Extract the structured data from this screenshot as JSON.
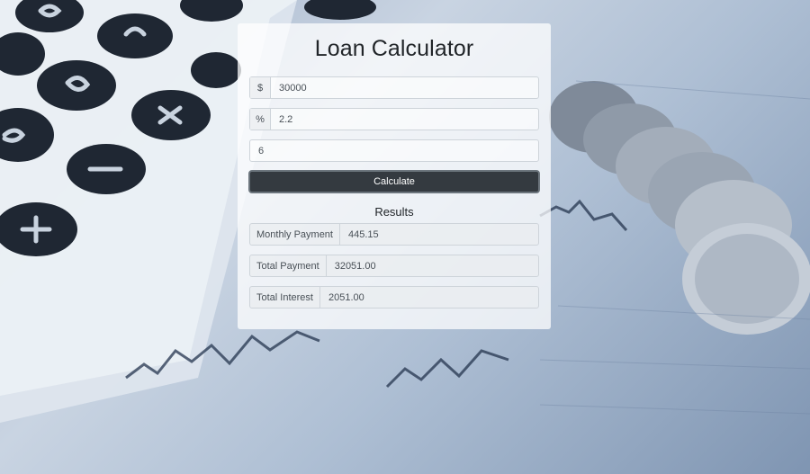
{
  "page": {
    "title": "Loan Calculator"
  },
  "form": {
    "amount": {
      "prefix": "$",
      "value": "30000"
    },
    "interest": {
      "prefix": "%",
      "value": "2.2"
    },
    "years": {
      "value": "6"
    },
    "calculate_label": "Calculate"
  },
  "results": {
    "heading": "Results",
    "monthly_payment": {
      "label": "Monthly Payment",
      "value": "445.15"
    },
    "total_payment": {
      "label": "Total Payment",
      "value": "32051.00"
    },
    "total_interest": {
      "label": "Total Interest",
      "value": "2051.00"
    }
  },
  "colors": {
    "button_bg": "#343a40",
    "card_bg": "rgba(255,255,255,0.74)"
  }
}
